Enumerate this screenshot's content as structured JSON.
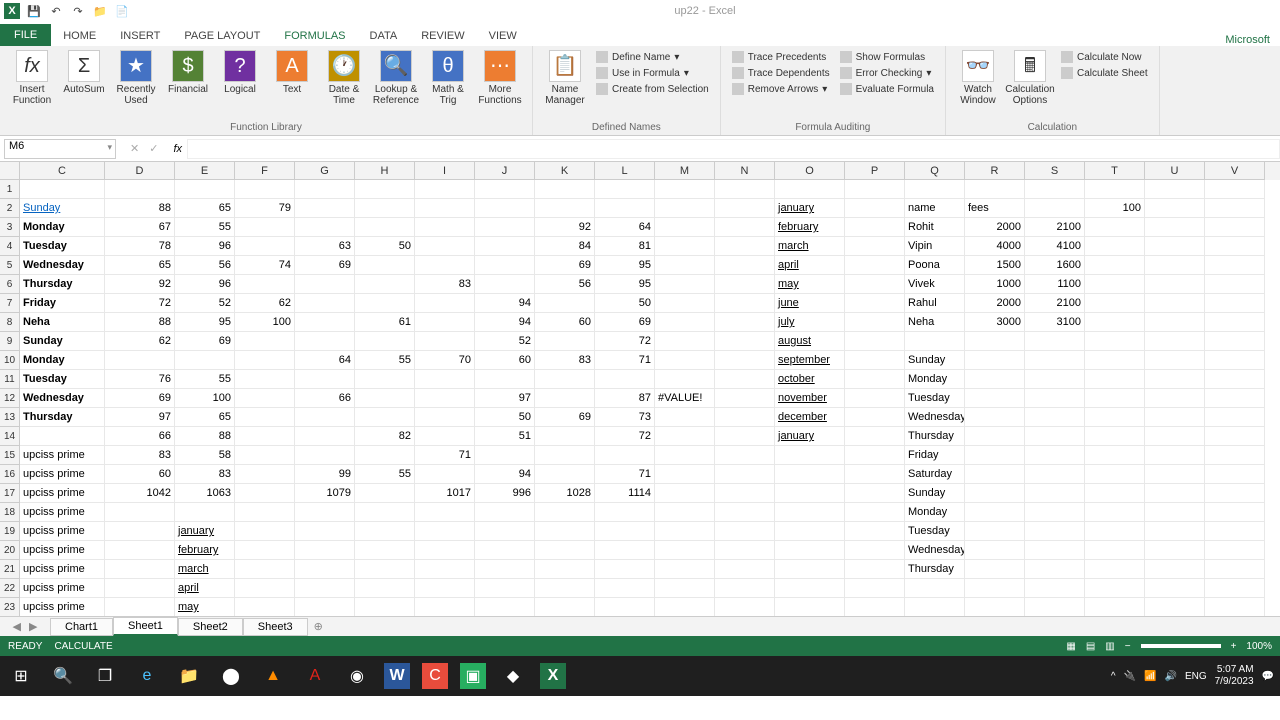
{
  "titlebar": {
    "title": "up22 - Excel"
  },
  "tabs": {
    "file": "FILE",
    "home": "HOME",
    "insert": "INSERT",
    "pagelayout": "PAGE LAYOUT",
    "formulas": "FORMULAS",
    "data": "DATA",
    "review": "REVIEW",
    "view": "VIEW",
    "right": "Microsoft"
  },
  "ribbon": {
    "insert_function": "Insert Function",
    "autosum": "AutoSum",
    "recently_used": "Recently Used",
    "financial": "Financial",
    "logical": "Logical",
    "text": "Text",
    "datetime": "Date & Time",
    "lookup": "Lookup & Reference",
    "mathtrig": "Math & Trig",
    "more": "More Functions",
    "group1": "Function Library",
    "name_manager": "Name Manager",
    "define_name": "Define Name",
    "use_in_formula": "Use in Formula",
    "create_from_sel": "Create from Selection",
    "group2": "Defined Names",
    "trace_prec": "Trace Precedents",
    "trace_dep": "Trace Dependents",
    "remove_arrows": "Remove Arrows",
    "show_formulas": "Show Formulas",
    "error_check": "Error Checking",
    "eval_formula": "Evaluate Formula",
    "group3": "Formula Auditing",
    "watch": "Watch Window",
    "calc_opts": "Calculation Options",
    "calc_now": "Calculate Now",
    "calc_sheet": "Calculate Sheet",
    "group4": "Calculation"
  },
  "namebox": "M6",
  "columns": [
    "C",
    "D",
    "E",
    "F",
    "G",
    "H",
    "I",
    "J",
    "K",
    "L",
    "M",
    "N",
    "O",
    "P",
    "Q",
    "R",
    "S",
    "T",
    "U",
    "V"
  ],
  "rows": [
    {
      "n": 1,
      "cells": {}
    },
    {
      "n": 2,
      "cells": {
        "C": {
          "v": "Sunday",
          "cls": "link"
        },
        "D": {
          "v": "88",
          "r": 1
        },
        "E": {
          "v": "65",
          "r": 1
        },
        "F": {
          "v": "79",
          "r": 1
        },
        "O": {
          "v": "january",
          "cls": "ul"
        },
        "Q": {
          "v": "name"
        },
        "R": {
          "v": "fees"
        },
        "T": {
          "v": "100",
          "r": 1
        }
      }
    },
    {
      "n": 3,
      "cells": {
        "C": {
          "v": "Monday",
          "cls": "bold"
        },
        "D": {
          "v": "67",
          "r": 1
        },
        "E": {
          "v": "55",
          "r": 1
        },
        "K": {
          "v": "92",
          "r": 1
        },
        "L": {
          "v": "64",
          "r": 1
        },
        "O": {
          "v": "february",
          "cls": "ul"
        },
        "Q": {
          "v": "Rohit"
        },
        "R": {
          "v": "2000",
          "r": 1
        },
        "S": {
          "v": "2100",
          "r": 1
        }
      }
    },
    {
      "n": 4,
      "cells": {
        "C": {
          "v": "Tuesday",
          "cls": "bold"
        },
        "D": {
          "v": "78",
          "r": 1
        },
        "E": {
          "v": "96",
          "r": 1
        },
        "G": {
          "v": "63",
          "r": 1
        },
        "H": {
          "v": "50",
          "r": 1
        },
        "K": {
          "v": "84",
          "r": 1
        },
        "L": {
          "v": "81",
          "r": 1
        },
        "O": {
          "v": "march",
          "cls": "ul"
        },
        "Q": {
          "v": "Vipin"
        },
        "R": {
          "v": "4000",
          "r": 1
        },
        "S": {
          "v": "4100",
          "r": 1
        }
      }
    },
    {
      "n": 5,
      "cells": {
        "C": {
          "v": "Wednesday",
          "cls": "bold"
        },
        "D": {
          "v": "65",
          "r": 1
        },
        "E": {
          "v": "56",
          "r": 1
        },
        "F": {
          "v": "74",
          "r": 1
        },
        "G": {
          "v": "69",
          "r": 1
        },
        "K": {
          "v": "69",
          "r": 1
        },
        "L": {
          "v": "95",
          "r": 1
        },
        "O": {
          "v": "april",
          "cls": "ul"
        },
        "Q": {
          "v": "Poona"
        },
        "R": {
          "v": "1500",
          "r": 1
        },
        "S": {
          "v": "1600",
          "r": 1
        }
      }
    },
    {
      "n": 6,
      "cells": {
        "C": {
          "v": "Thursday",
          "cls": "bold"
        },
        "D": {
          "v": "92",
          "r": 1
        },
        "E": {
          "v": "96",
          "r": 1
        },
        "I": {
          "v": "83",
          "r": 1
        },
        "K": {
          "v": "56",
          "r": 1
        },
        "L": {
          "v": "95",
          "r": 1
        },
        "O": {
          "v": "may",
          "cls": "ul"
        },
        "Q": {
          "v": "Vivek"
        },
        "R": {
          "v": "1000",
          "r": 1
        },
        "S": {
          "v": "1100",
          "r": 1
        }
      }
    },
    {
      "n": 7,
      "cells": {
        "C": {
          "v": "Friday",
          "cls": "bold"
        },
        "D": {
          "v": "72",
          "r": 1
        },
        "E": {
          "v": "52",
          "r": 1
        },
        "F": {
          "v": "62",
          "r": 1
        },
        "J": {
          "v": "94",
          "r": 1
        },
        "L": {
          "v": "50",
          "r": 1
        },
        "O": {
          "v": "june",
          "cls": "ul"
        },
        "Q": {
          "v": "Rahul"
        },
        "R": {
          "v": "2000",
          "r": 1
        },
        "S": {
          "v": "2100",
          "r": 1
        }
      }
    },
    {
      "n": 8,
      "cells": {
        "C": {
          "v": "Neha",
          "cls": "bold"
        },
        "D": {
          "v": "88",
          "r": 1
        },
        "E": {
          "v": "95",
          "r": 1
        },
        "F": {
          "v": "100",
          "r": 1
        },
        "H": {
          "v": "61",
          "r": 1
        },
        "J": {
          "v": "94",
          "r": 1
        },
        "K": {
          "v": "60",
          "r": 1
        },
        "L": {
          "v": "69",
          "r": 1
        },
        "O": {
          "v": "july",
          "cls": "ul"
        },
        "Q": {
          "v": "Neha"
        },
        "R": {
          "v": "3000",
          "r": 1
        },
        "S": {
          "v": "3100",
          "r": 1
        }
      }
    },
    {
      "n": 9,
      "cells": {
        "C": {
          "v": "Sunday",
          "cls": "bold"
        },
        "D": {
          "v": "62",
          "r": 1
        },
        "E": {
          "v": "69",
          "r": 1
        },
        "J": {
          "v": "52",
          "r": 1
        },
        "L": {
          "v": "72",
          "r": 1
        },
        "O": {
          "v": "august",
          "cls": "ul"
        }
      }
    },
    {
      "n": 10,
      "cells": {
        "C": {
          "v": "Monday",
          "cls": "bold"
        },
        "G": {
          "v": "64",
          "r": 1
        },
        "H": {
          "v": "55",
          "r": 1
        },
        "I": {
          "v": "70",
          "r": 1
        },
        "J": {
          "v": "60",
          "r": 1
        },
        "K": {
          "v": "83",
          "r": 1
        },
        "L": {
          "v": "71",
          "r": 1
        },
        "O": {
          "v": "september",
          "cls": "ul"
        },
        "Q": {
          "v": "Sunday"
        }
      }
    },
    {
      "n": 11,
      "cells": {
        "C": {
          "v": "Tuesday",
          "cls": "bold"
        },
        "D": {
          "v": "76",
          "r": 1
        },
        "E": {
          "v": "55",
          "r": 1
        },
        "O": {
          "v": "october",
          "cls": "ul"
        },
        "Q": {
          "v": "Monday"
        }
      }
    },
    {
      "n": 12,
      "cells": {
        "C": {
          "v": "Wednesday",
          "cls": "bold"
        },
        "D": {
          "v": "69",
          "r": 1
        },
        "E": {
          "v": "100",
          "r": 1
        },
        "G": {
          "v": "66",
          "r": 1
        },
        "J": {
          "v": "97",
          "r": 1
        },
        "L": {
          "v": "87",
          "r": 1
        },
        "M": {
          "v": "#VALUE!"
        },
        "O": {
          "v": "november",
          "cls": "ul"
        },
        "Q": {
          "v": "Tuesday"
        }
      }
    },
    {
      "n": 13,
      "cells": {
        "C": {
          "v": "Thursday",
          "cls": "bold"
        },
        "D": {
          "v": "97",
          "r": 1
        },
        "E": {
          "v": "65",
          "r": 1
        },
        "J": {
          "v": "50",
          "r": 1
        },
        "K": {
          "v": "69",
          "r": 1
        },
        "L": {
          "v": "73",
          "r": 1
        },
        "O": {
          "v": "december",
          "cls": "ul"
        },
        "Q": {
          "v": "Wednesday"
        }
      }
    },
    {
      "n": 14,
      "cells": {
        "D": {
          "v": "66",
          "r": 1
        },
        "E": {
          "v": "88",
          "r": 1
        },
        "H": {
          "v": "82",
          "r": 1
        },
        "J": {
          "v": "51",
          "r": 1
        },
        "L": {
          "v": "72",
          "r": 1
        },
        "O": {
          "v": "january",
          "cls": "ul"
        },
        "Q": {
          "v": "Thursday"
        }
      }
    },
    {
      "n": 15,
      "cells": {
        "C": {
          "v": "upciss prime"
        },
        "D": {
          "v": "83",
          "r": 1
        },
        "E": {
          "v": "58",
          "r": 1
        },
        "I": {
          "v": "71",
          "r": 1
        },
        "Q": {
          "v": "Friday"
        }
      }
    },
    {
      "n": 16,
      "cells": {
        "C": {
          "v": "upciss prime"
        },
        "D": {
          "v": "60",
          "r": 1
        },
        "E": {
          "v": "83",
          "r": 1
        },
        "G": {
          "v": "99",
          "r": 1
        },
        "H": {
          "v": "55",
          "r": 1
        },
        "J": {
          "v": "94",
          "r": 1
        },
        "L": {
          "v": "71",
          "r": 1
        },
        "Q": {
          "v": "Saturday"
        }
      }
    },
    {
      "n": 17,
      "cells": {
        "C": {
          "v": "upciss prime"
        },
        "D": {
          "v": "1042",
          "r": 1
        },
        "E": {
          "v": "1063",
          "r": 1
        },
        "G": {
          "v": "1079",
          "r": 1
        },
        "I": {
          "v": "1017",
          "r": 1
        },
        "J": {
          "v": "996",
          "r": 1
        },
        "K": {
          "v": "1028",
          "r": 1
        },
        "L": {
          "v": "1114",
          "r": 1
        },
        "Q": {
          "v": "Sunday"
        }
      }
    },
    {
      "n": 18,
      "cells": {
        "C": {
          "v": "upciss prime"
        },
        "Q": {
          "v": "Monday"
        }
      }
    },
    {
      "n": 19,
      "cells": {
        "C": {
          "v": "upciss prime"
        },
        "E": {
          "v": "january",
          "cls": "ul"
        },
        "Q": {
          "v": "Tuesday"
        }
      }
    },
    {
      "n": 20,
      "cells": {
        "C": {
          "v": "upciss prime"
        },
        "E": {
          "v": "february",
          "cls": "ul"
        },
        "Q": {
          "v": "Wednesday"
        }
      }
    },
    {
      "n": 21,
      "cells": {
        "C": {
          "v": "upciss prime"
        },
        "E": {
          "v": "march",
          "cls": "ul"
        },
        "Q": {
          "v": "Thursday"
        }
      }
    },
    {
      "n": 22,
      "cells": {
        "C": {
          "v": "upciss prime"
        },
        "E": {
          "v": "april",
          "cls": "ul"
        }
      }
    },
    {
      "n": 23,
      "cells": {
        "C": {
          "v": "upciss prime"
        },
        "E": {
          "v": "may",
          "cls": "ul"
        }
      }
    }
  ],
  "sheets": {
    "nav": [
      "◀",
      "▶"
    ],
    "chart1": "Chart1",
    "sheet1": "Sheet1",
    "sheet2": "Sheet2",
    "sheet3": "Sheet3",
    "add": "⊕"
  },
  "statusbar": {
    "ready": "READY",
    "calculate": "CALCULATE",
    "zoom": "100%"
  },
  "taskbar": {
    "lang": "ENG",
    "time": "5:07 AM",
    "date": "7/9/2023"
  }
}
